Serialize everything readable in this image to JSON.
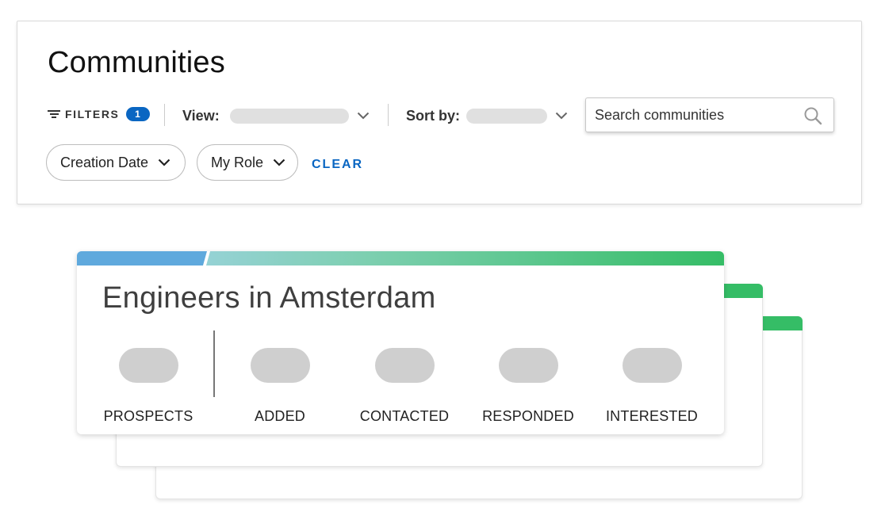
{
  "header": {
    "title": "Communities",
    "filters_label": "FILTERS",
    "filters_count": "1",
    "view_label": "View:",
    "sort_label": "Sort by:",
    "search_placeholder": "Search communities",
    "chips": [
      {
        "label": "Creation Date"
      },
      {
        "label": "My Role"
      }
    ],
    "clear_label": "CLEAR"
  },
  "community_card": {
    "title": "Engineers in Amsterdam",
    "stats": [
      {
        "label": "PROSPECTS"
      },
      {
        "label": "ADDED"
      },
      {
        "label": "CONTACTED"
      },
      {
        "label": "RESPONDED"
      },
      {
        "label": "INTERESTED"
      }
    ]
  },
  "colors": {
    "accent_blue": "#0a66c2",
    "bar_blue": "#5fa9dd",
    "bar_green": "#35bd66",
    "placeholder_gray": "#cfcfcf"
  },
  "icons": {
    "filters": "filter-lines-icon",
    "dropdown": "chevron-down-icon",
    "search": "magnifier-icon"
  }
}
